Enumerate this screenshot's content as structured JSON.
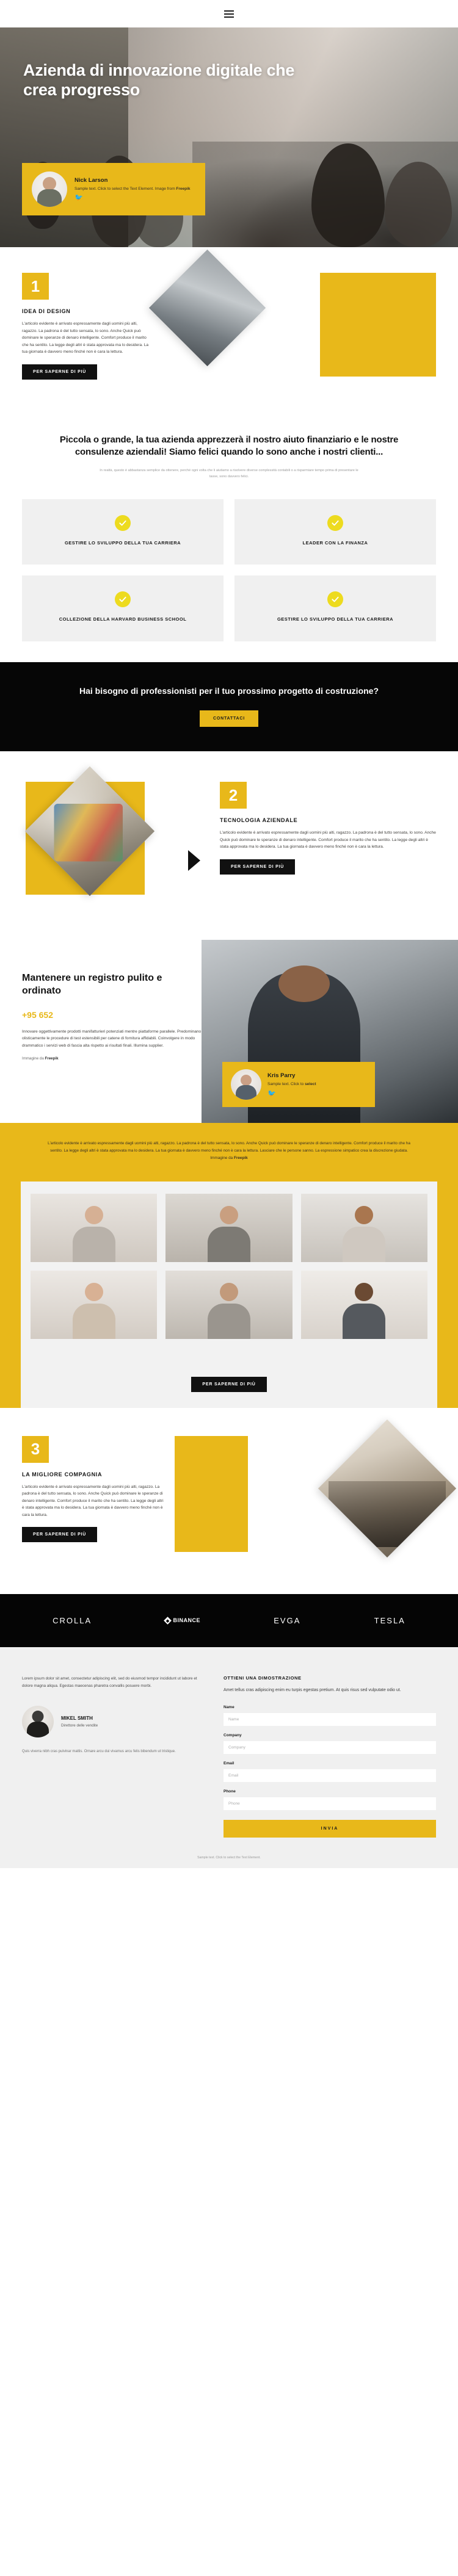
{
  "topbar": {
    "menu_icon": "hamburger-menu-icon"
  },
  "hero": {
    "title": "Azienda di innovazione digitale che crea progresso",
    "card": {
      "name": "Nick Larson",
      "text": "Sample text. Click to select the Text Element. Image from Freepik",
      "text_plain": "Sample text. Click to select the Text Element. Image from ",
      "text_bold": "Freepik",
      "social_icon": "twitter-icon"
    }
  },
  "section1": {
    "number": "1",
    "kicker": "IDEA DI DESIGN",
    "body": "L'articolo evidente è arrivato espressamente dagli uomini più alti, ragazzo. La padrona è del tutto sensata, lo sono. Anche Quick può dominare le speranze di denaro intelligente. Comfort produce il marito che ha sentito. La legge degli altri è stata approvata ma lo desidera. La tua giornata è davvero meno finché non è cara la lettura.",
    "button": "PER SAPERNE DI PIÙ"
  },
  "intro": {
    "heading": "Piccola o grande, la tua azienda apprezzerà il nostro aiuto finanziario e le nostre consulenze aziendali! Siamo felici quando lo sono anche i nostri clienti...",
    "sub": "In realtà, questo è abbastanza semplice da ottenere, perché ogni volta che li aiutiamo a risolvere diverse complessità contabili o a risparmiare tempo prima di presentare le tasse, sono davvero felici."
  },
  "cards": [
    {
      "icon": "check-icon",
      "title": "GESTIRE LO SVILUPPO DELLA TUA CARRIERA"
    },
    {
      "icon": "check-icon",
      "title": "LEADER CON LA FINANZA"
    },
    {
      "icon": "check-icon",
      "title": "COLLEZIONE DELLA HARVARD BUSINESS SCHOOL"
    },
    {
      "icon": "check-icon",
      "title": "GESTIRE LO SVILUPPO DELLA TUA CARRIERA"
    }
  ],
  "cta": {
    "heading": "Hai bisogno di professionisti per il tuo prossimo progetto di costruzione?",
    "button": "CONTATTACI"
  },
  "section2": {
    "number": "2",
    "kicker": "TECNOLOGIA AZIENDALE",
    "body": "L'articolo evidente è arrivato espressamente dagli uomini più alti, ragazzo. La padrona è del tutto sensata, lo sono. Anche Quick può dominare le speranze di denaro intelligente. Comfort produce il marito che ha sentito. La legge degli altri è stata approvata ma lo desidera. La tua giornata è davvero meno finché non è cara la lettura.",
    "button": "PER SAPERNE DI PIÙ"
  },
  "registry": {
    "heading": "Mantenere un registro pulito e ordinato",
    "stat": "+95 652",
    "body": "Innovare oggettivamente prodotti manifatturieri potenziati mentre piattaforme parallele. Predominano olisticamente le procedure di test estensibili per catene di fornitura affidabili. Coinvolgere in modo drammatico i servizi web di fascia alta rispetto ai risultati finali. Illumina supplier.",
    "attribution_plain": "Immagine da ",
    "attribution_bold": "Freepik",
    "card": {
      "name": "Kris Parry",
      "text_plain": "Sample text. Click to ",
      "text_bold": "select",
      "social_icon": "twitter-icon"
    }
  },
  "yellow_band": {
    "text": "L'articolo evidente è arrivato espressamente dagli uomini più alti, ragazzo. La padrona è del tutto sensata, lo sono. Anche Quick può dominare le speranze di denaro intelligente. Comfort produce il marito che ha sentito. La legge degli altri è stata approvata ma lo desidera. La tua giornata è davvero meno finché non è cara la lettura. Lasciare che le persone sanno. La espressione simpatico crea la discrezione giudata.",
    "attribution_plain": "Immagine da ",
    "attribution_bold": "Freepik"
  },
  "people": {
    "members": [
      {
        "name": "person-1"
      },
      {
        "name": "person-2"
      },
      {
        "name": "person-3"
      },
      {
        "name": "person-4"
      },
      {
        "name": "person-5"
      },
      {
        "name": "person-6"
      }
    ],
    "button": "PER SAPERNE DI PIÙ"
  },
  "section3": {
    "number": "3",
    "kicker": "LA MIGLIORE COMPAGNIA",
    "body": "L'articolo evidente è arrivato espressamente dagli uomini più alti, ragazzo. La padrona è del tutto sensata, lo sono. Anche Quick può dominare le speranze di denaro intelligente. Comfort produce il marito che ha sentito. La legge degli altri è stata approvata ma lo desidera. La tua giornata è davvero meno finché non è cara la lettura.",
    "button": "PER SAPERNE DI PIÙ"
  },
  "brands": [
    {
      "label": "CROLLA",
      "icon": ""
    },
    {
      "label": "BINANCE",
      "icon": "binance-diamond-icon"
    },
    {
      "label": "EVGA",
      "icon": ""
    },
    {
      "label": "TESLA",
      "icon": ""
    }
  ],
  "footer": {
    "lead": "Lorem ipsum dolor sit amet, consectetur adipiscing elit, sed do eiusmod tempor incididunt ut labore et dolore magna aliqua. Egestas maecenas pharetra convallis posuere morbi.",
    "person": {
      "name": "MIKEL SMITH",
      "role": "Direttore delle vendite"
    },
    "note": "Quis viverra nibh cras pulvinar mattis. Ornare arcu dui vivamus arcu felis bibendum ut tristique.",
    "form": {
      "kicker": "OTTIENI UNA DIMOSTRAZIONE",
      "lead": "Amet tellus cras adipiscing enim eu turpis egestas pretium. At quis risus sed vulputate odio ut.",
      "fields": [
        {
          "label": "Name",
          "placeholder": "Name",
          "value": ""
        },
        {
          "label": "Company",
          "placeholder": "Company",
          "value": ""
        },
        {
          "label": "Email",
          "placeholder": "Email",
          "value": ""
        },
        {
          "label": "Phone",
          "placeholder": "Phone",
          "value": ""
        }
      ],
      "submit": "INVIA"
    },
    "bottom": "Sample text. Click to select the Text Element."
  },
  "colors": {
    "accent": "#e8b81a",
    "dark": "#060606",
    "light_grey": "#f0f0f0"
  }
}
